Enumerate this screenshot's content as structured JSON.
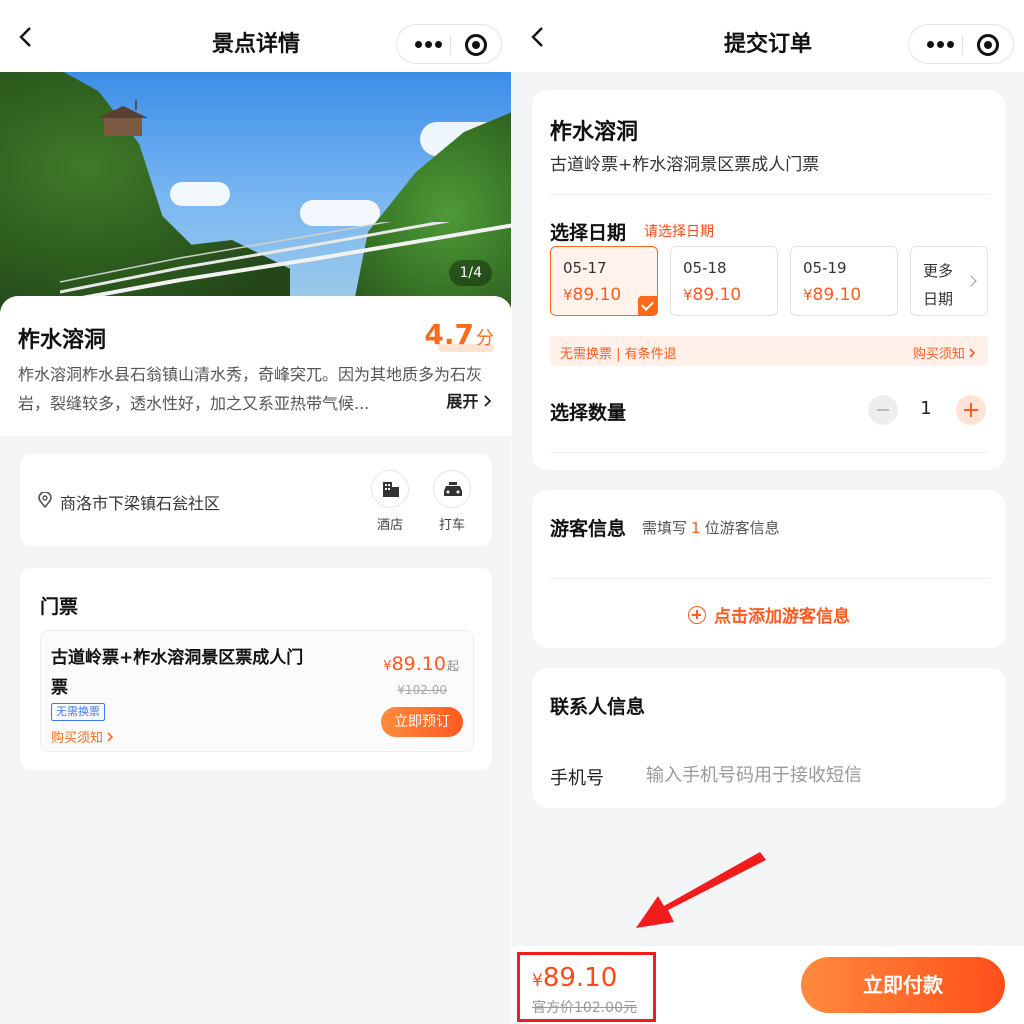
{
  "left": {
    "nav": {
      "title": "景点详情"
    },
    "hero": {
      "pager": "1/4"
    },
    "spot": {
      "name": "柞水溶洞",
      "rating": "4.7",
      "rating_unit": "分",
      "description": "柞水溶洞柞水县石翁镇山清水秀，奇峰突兀。因为其地质多为石灰岩，裂缝较多，透水性好，加之又系亚热带气候...",
      "expand_label": "展开"
    },
    "address": {
      "text": "商洛市下梁镇石瓮社区",
      "hotel_label": "酒店",
      "taxi_label": "打车"
    },
    "tickets": {
      "heading": "门票",
      "item": {
        "title": "古道岭票+柞水溶洞景区票成人门票",
        "badge": "无需换票",
        "notes": "购买须知",
        "currency": "¥",
        "price": "89.10",
        "price_suffix": "起",
        "original_price": "¥102.00",
        "book_label": "立即预订"
      }
    }
  },
  "right": {
    "nav": {
      "title": "提交订单"
    },
    "product": {
      "name": "柞水溶洞",
      "subtitle": "古道岭票+柞水溶洞景区票成人门票"
    },
    "date": {
      "heading": "选择日期",
      "hint": "请选择日期",
      "options": [
        {
          "date": "05-17",
          "currency": "¥",
          "price": "89.10",
          "selected": true
        },
        {
          "date": "05-18",
          "currency": "¥",
          "price": "89.10",
          "selected": false
        },
        {
          "date": "05-19",
          "currency": "¥",
          "price": "89.10",
          "selected": false
        }
      ],
      "more_label": "更多日期"
    },
    "notice": {
      "left": "无需换票 | 有条件退",
      "right": "购买须知"
    },
    "quantity": {
      "heading": "选择数量",
      "value": "1"
    },
    "guest": {
      "heading": "游客信息",
      "hint_prefix": "需填写",
      "hint_count": "1",
      "hint_suffix": "位游客信息",
      "add_label": "点击添加游客信息"
    },
    "contact": {
      "heading": "联系人信息",
      "phone_label": "手机号",
      "phone_placeholder": "输入手机号码用于接收短信",
      "phone_value": ""
    },
    "paybar": {
      "currency": "¥",
      "total": "89.10",
      "official_price": "官方价102.00元",
      "pay_label": "立即付款"
    }
  },
  "colors": {
    "accent": "#ff5a1f",
    "highlight_box": "#f21c1c",
    "link_blue": "#3d7cf0"
  },
  "icons": [
    "back-icon",
    "more-dots-icon",
    "target-icon",
    "location-pin-icon",
    "hotel-icon",
    "taxi-icon",
    "chevron-right-icon",
    "minus-icon",
    "plus-icon",
    "add-circle-icon",
    "check-icon",
    "red-arrow-annotation"
  ]
}
